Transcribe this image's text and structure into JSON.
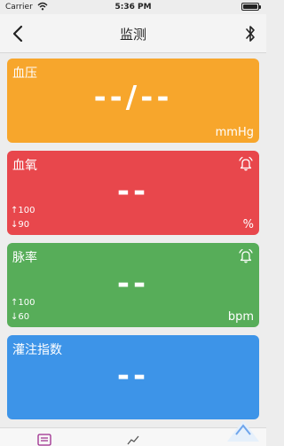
{
  "status_bar": {
    "carrier": "Carrier",
    "time": "5:36 PM"
  },
  "nav": {
    "title": "监测",
    "back_icon": "chevron-left-icon",
    "right_icon": "bluetooth-icon"
  },
  "cards": {
    "bp": {
      "label": "血压",
      "value": "--/--",
      "unit": "mmHg",
      "color": "#f7a62c"
    },
    "spo2": {
      "label": "血氧",
      "value": "--",
      "unit": "%",
      "high": "↑100",
      "low": "↓90",
      "color": "#e8474c",
      "alarm_icon": "alarm-bell-icon"
    },
    "pr": {
      "label": "脉率",
      "value": "--",
      "unit": "bpm",
      "high": "↑100",
      "low": "↓60",
      "color": "#57ad59",
      "alarm_icon": "alarm-bell-icon"
    },
    "pi": {
      "label": "灌注指数",
      "value": "--",
      "color": "#3d94e8"
    }
  },
  "tabs": [
    {
      "icon": "list-icon",
      "active": true,
      "color": "#9c2a8c"
    },
    {
      "icon": "trend-chart-icon",
      "active": false,
      "color": "#555555"
    }
  ]
}
